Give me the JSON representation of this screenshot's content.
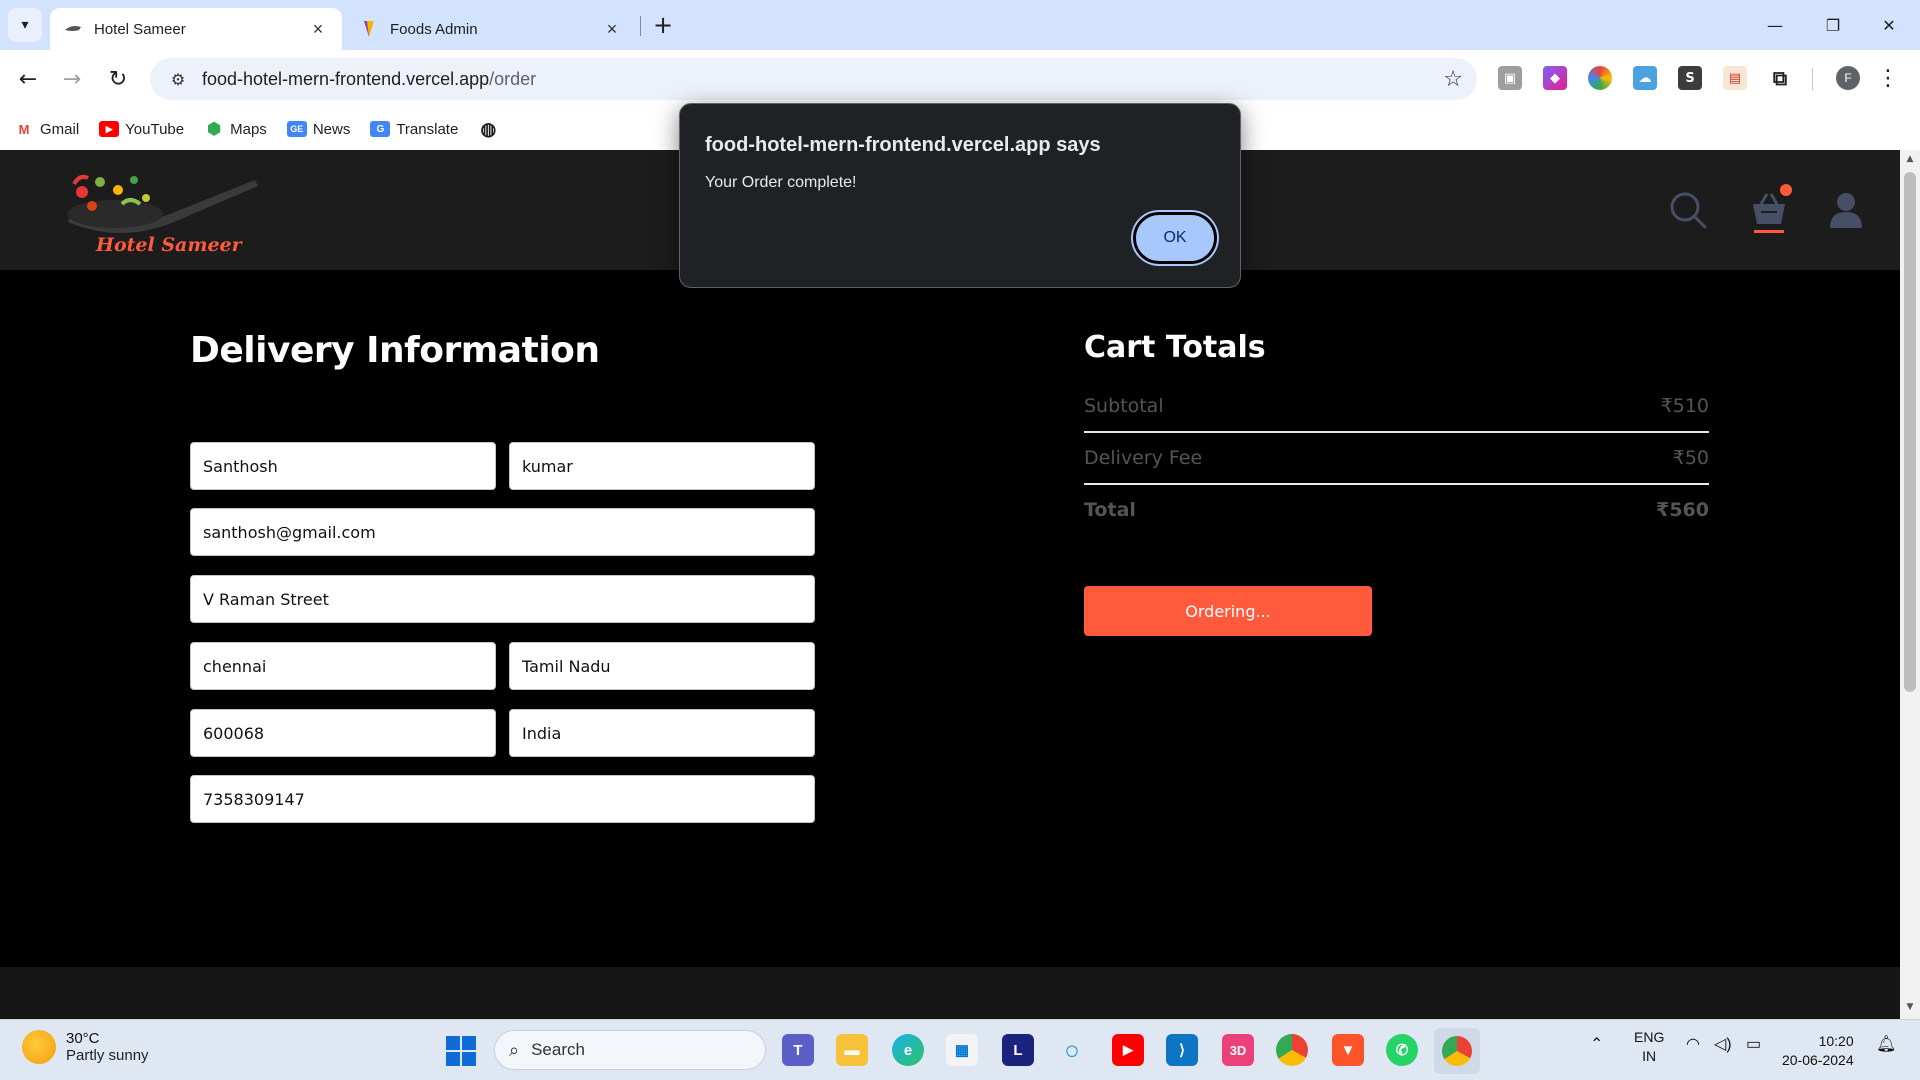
{
  "browser": {
    "tabs": [
      {
        "title": "Hotel Sameer",
        "active": true
      },
      {
        "title": "Foods Admin",
        "active": false
      }
    ],
    "url_host": "food-hotel-mern-frontend.vercel.app",
    "url_path": "/order",
    "profile_initial": "F",
    "bookmarks": [
      "Gmail",
      "YouTube",
      "Maps",
      "News",
      "Translate"
    ]
  },
  "site": {
    "logo_text": "Hotel Sameer",
    "accent_color": "#ff5a3c"
  },
  "delivery": {
    "title": "Delivery Information",
    "first_name": "Santhosh",
    "last_name": "kumar",
    "email": "santhosh@gmail.com",
    "street": "V Raman Street",
    "city": "chennai",
    "state": "Tamil Nadu",
    "zip": "600068",
    "country": "India",
    "phone": "7358309147"
  },
  "cart": {
    "title": "Cart Totals",
    "subtotal_label": "Subtotal",
    "subtotal_value": "₹510",
    "delivery_label": "Delivery Fee",
    "delivery_value": "₹50",
    "total_label": "Total",
    "total_value": "₹560",
    "button_label": "Ordering..."
  },
  "dialog": {
    "title": "food-hotel-mern-frontend.vercel.app says",
    "message": "Your Order complete!",
    "ok_label": "OK"
  },
  "taskbar": {
    "temperature": "30°C",
    "weather": "Partly sunny",
    "search_label": "Search",
    "lang_line1": "ENG",
    "lang_line2": "IN",
    "time": "10:20",
    "date": "20-06-2024",
    "apps": [
      "teams-icon",
      "file-explorer-icon",
      "edge-icon",
      "store-icon",
      "l-app-icon",
      "cortana-icon",
      "youtube-icon",
      "vscode-icon",
      "3d-app-icon",
      "chrome-icon",
      "brave-icon",
      "whatsapp-icon",
      "chrome-profile-icon"
    ]
  }
}
